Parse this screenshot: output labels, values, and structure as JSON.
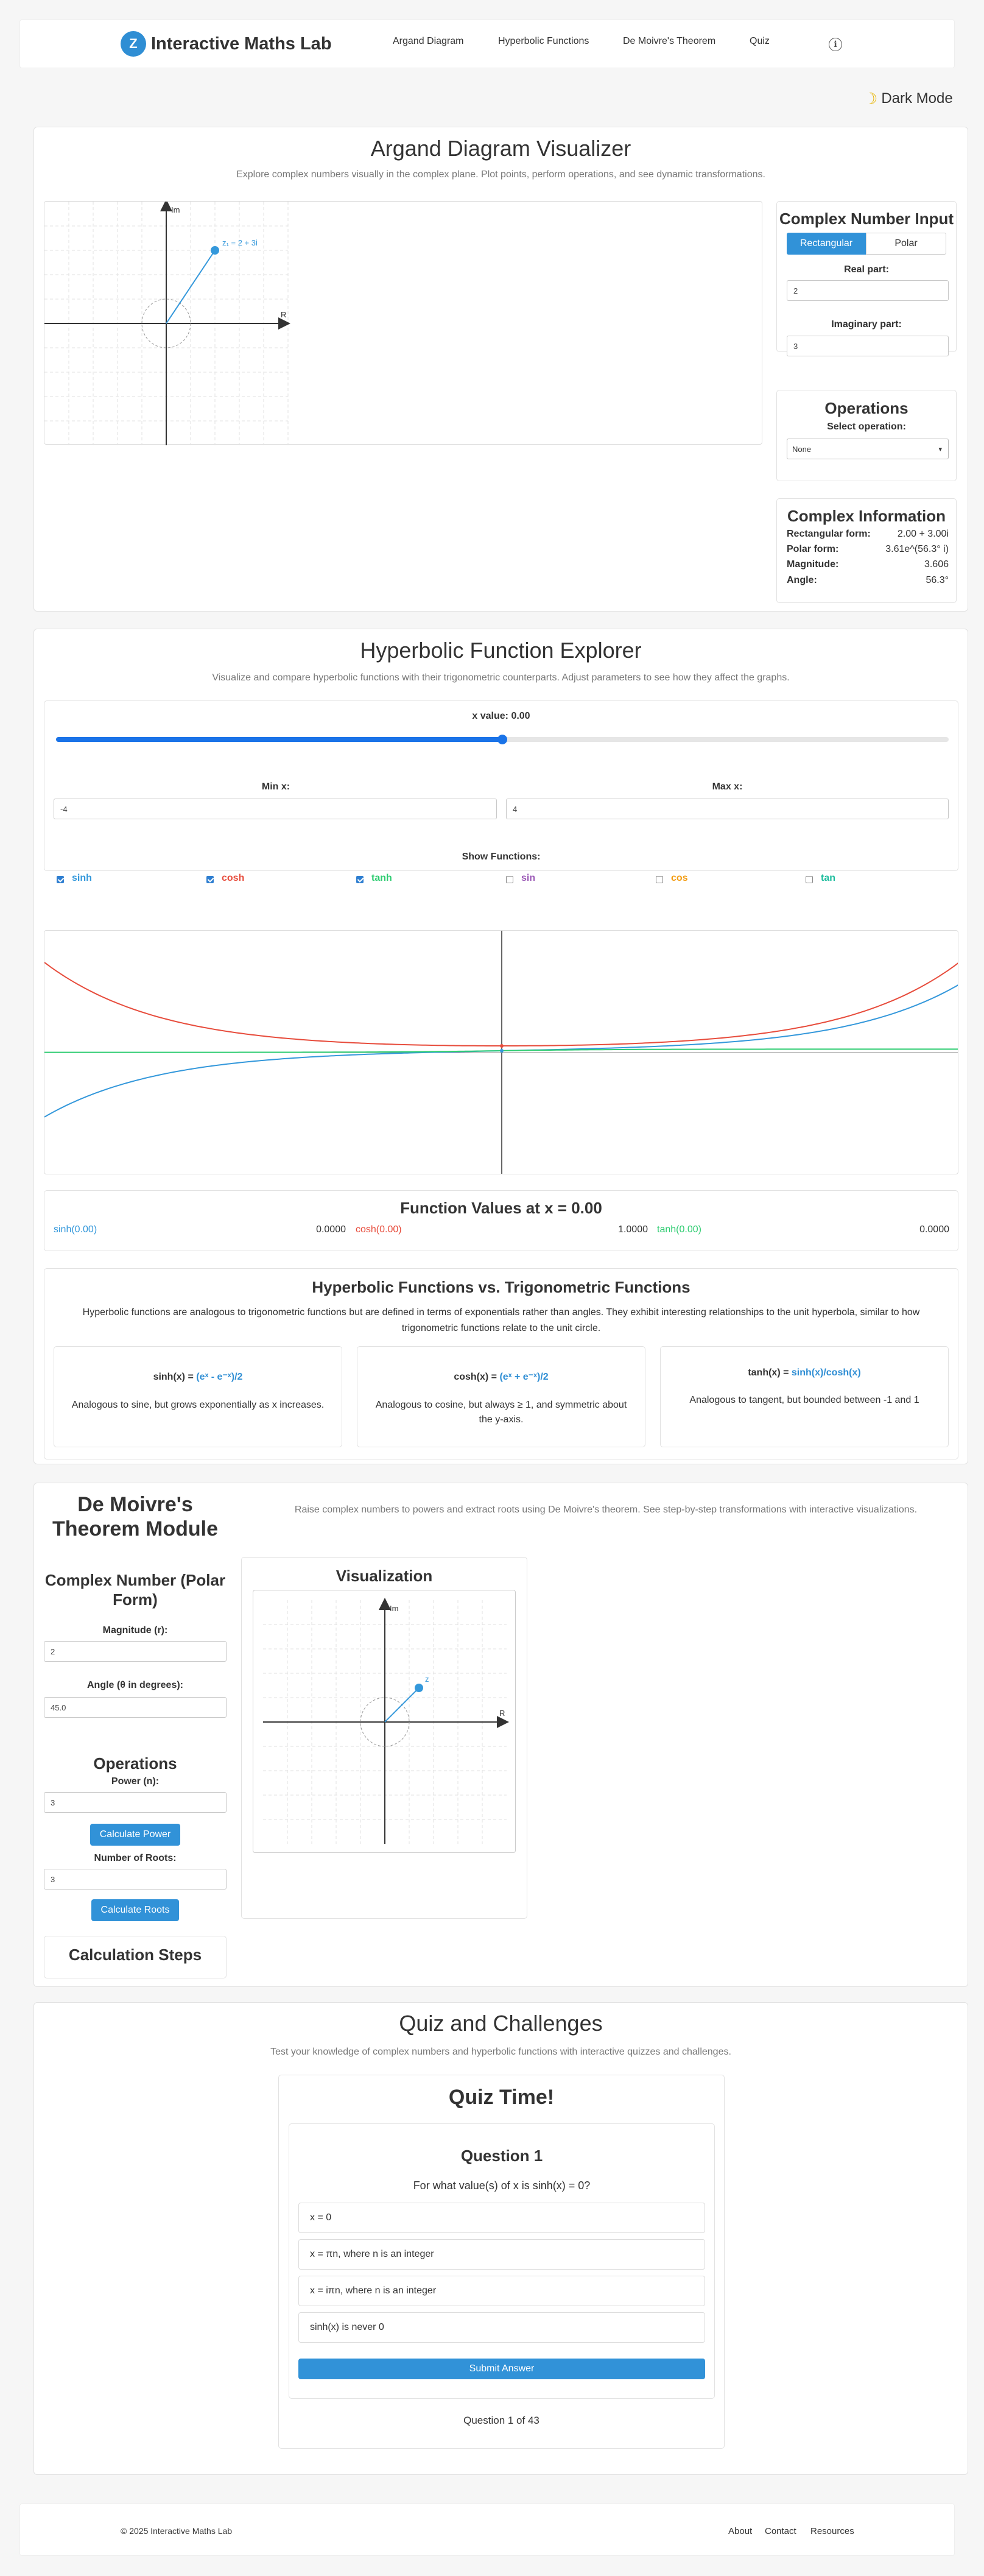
{
  "nav": {
    "logo_letter": "Z",
    "brand": "Interactive Maths Lab",
    "links": [
      "Argand Diagram",
      "Hyperbolic Functions",
      "De Moivre's Theorem",
      "Quiz"
    ],
    "info_icon": "info-icon"
  },
  "dark_mode": {
    "icon": "moon-icon",
    "label": "Dark Mode"
  },
  "argand": {
    "title": "Argand Diagram Visualizer",
    "subtitle": "Explore complex numbers visually in the complex plane. Plot points, perform operations, and see dynamic transformations.",
    "axis_re": "R",
    "axis_im": "Im",
    "point_label": "z₁ = 2 + 3i",
    "input_title": "Complex Number Input",
    "tab_rect": "Rectangular",
    "tab_polar": "Polar",
    "real_label": "Real part:",
    "real_value": "2",
    "imag_label": "Imaginary part:",
    "imag_value": "3",
    "ops_title": "Operations",
    "ops_label": "Select operation:",
    "ops_value": "None",
    "info_title": "Complex Information",
    "info_rows": [
      {
        "k": "Rectangular form:",
        "v": "2.00 + 3.00i"
      },
      {
        "k": "Polar form:",
        "v": "3.61e^(56.3° i)"
      },
      {
        "k": "Magnitude:",
        "v": "3.606"
      },
      {
        "k": "Angle:",
        "v": "56.3°"
      }
    ]
  },
  "hyper": {
    "title": "Hyperbolic Function Explorer",
    "subtitle": "Visualize and compare hyperbolic functions with their trigonometric counterparts. Adjust parameters to see how they affect the graphs.",
    "x_label": "x value: 0.00",
    "slider_fraction": 0.5,
    "min_label": "Min x:",
    "min_value": "-4",
    "max_label": "Max x:",
    "max_value": "4",
    "show_label": "Show Functions:",
    "functions": [
      {
        "name": "sinh",
        "checked": true,
        "color": "#3498db"
      },
      {
        "name": "cosh",
        "checked": true,
        "color": "#e74c3c"
      },
      {
        "name": "tanh",
        "checked": true,
        "color": "#2ecc71"
      },
      {
        "name": "sin",
        "checked": false,
        "color": "#9b59b6"
      },
      {
        "name": "cos",
        "checked": false,
        "color": "#f39c12"
      },
      {
        "name": "tan",
        "checked": false,
        "color": "#1abc9c"
      }
    ],
    "values_title": "Function Values at x = 0.00",
    "values": [
      {
        "name": "sinh(0.00)",
        "value": "0.0000"
      },
      {
        "name": "cosh(0.00)",
        "value": "1.0000"
      },
      {
        "name": "tanh(0.00)",
        "value": "0.0000"
      }
    ],
    "vs_title": "Hyperbolic Functions vs. Trigonometric Functions",
    "vs_text": "Hyperbolic functions are analogous to trigonometric functions but are defined in terms of exponentials rather than angles. They exhibit interesting relationships to the unit hyperbola, similar to how trigonometric functions relate to the unit circle.",
    "cards": [
      {
        "lhs": "sinh(x) = ",
        "rhs": "(eˣ - e⁻ˣ)/2",
        "desc": "Analogous to sine, but grows exponentially as x increases."
      },
      {
        "lhs": "cosh(x) = ",
        "rhs": "(eˣ + e⁻ˣ)/2",
        "desc": "Analogous to cosine, but always ≥ 1, and symmetric about the y-axis."
      },
      {
        "lhs": "tanh(x) = ",
        "rhs": "sinh(x)/cosh(x)",
        "desc": "Analogous to tangent, but bounded between -1 and 1"
      }
    ]
  },
  "demoivre": {
    "title": "De Moivre's Theorem Module",
    "subtitle": "Raise complex numbers to powers and extract roots using De Moivre's theorem. See step-by-step transformations with interactive visualizations.",
    "polar_title": "Complex Number (Polar Form)",
    "mag_label": "Magnitude (r):",
    "mag_value": "2",
    "angle_label": "Angle (θ in degrees):",
    "angle_value": "45.0",
    "ops_title": "Operations",
    "power_label": "Power (n):",
    "power_value": "3",
    "power_button": "Calculate Power",
    "roots_label": "Number of Roots:",
    "roots_value": "3",
    "roots_button": "Calculate Roots",
    "steps_title": "Calculation Steps",
    "viz_title": "Visualization",
    "axis_re": "R",
    "axis_im": "Im",
    "point_label": "z"
  },
  "quiz": {
    "title": "Quiz and Challenges",
    "subtitle": "Test your knowledge of complex numbers and hyperbolic functions with interactive quizzes and challenges.",
    "heading": "Quiz Time!",
    "question_title": "Question 1",
    "question": "For what value(s) of x is sinh(x) = 0?",
    "options": [
      "x = 0",
      "x = πn, where n is an integer",
      "x = iπn, where n is an integer",
      "sinh(x) is never 0"
    ],
    "submit": "Submit Answer",
    "progress": "Question 1 of 43"
  },
  "footer": {
    "copyright": "© 2025 Interactive Maths Lab",
    "links": [
      "About",
      "Contact",
      "Resources"
    ]
  }
}
